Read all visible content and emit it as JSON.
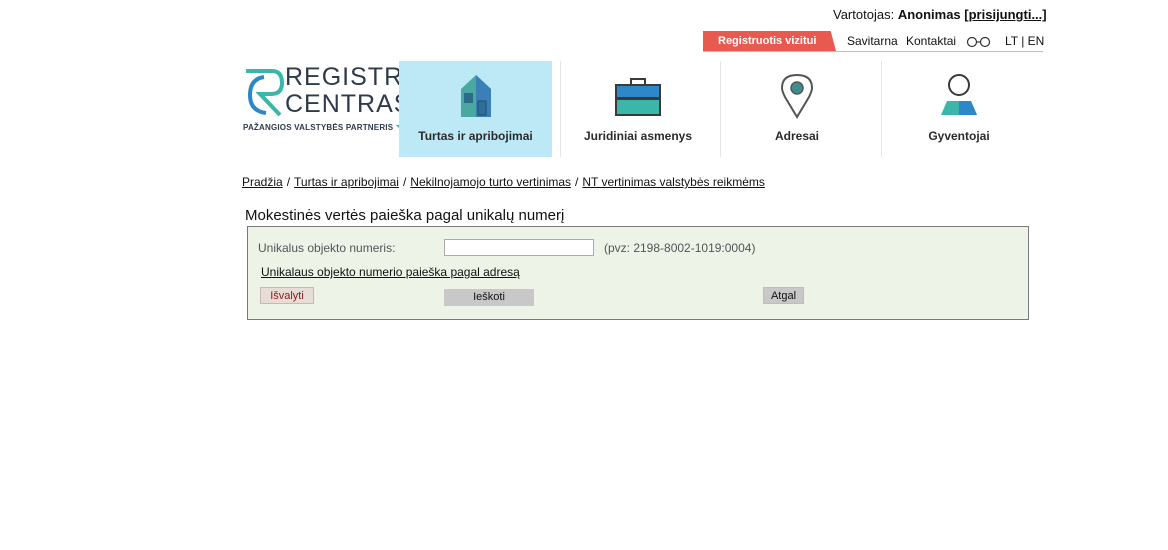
{
  "header": {
    "user_prefix": "Vartotojas:",
    "user_name": "Anonimas",
    "login_link": "[prisijungti...]",
    "register_button": "Registruotis vizitui",
    "links": [
      "Savitarna",
      "Kontaktai"
    ],
    "accessibility_icon": "glasses-icon",
    "language": "LT | EN"
  },
  "logo": {
    "title_line1": "REGISTRŲ",
    "title_line2": "CENTRAS",
    "subtitle": "PAŽANGIOS VALSTYBĖS PARTNERIS",
    "colors": {
      "teal": "#3bb7a9",
      "blue": "#2c88c9",
      "dark": "#2f3b4a"
    }
  },
  "nav": {
    "items": [
      {
        "label": "Turtas ir apribojimai",
        "icon": "house-icon",
        "active": true
      },
      {
        "label": "Juridiniai asmenys",
        "icon": "briefcase-icon",
        "active": false
      },
      {
        "label": "Adresai",
        "icon": "map-pin-icon",
        "active": false
      },
      {
        "label": "Gyventojai",
        "icon": "person-icon",
        "active": false
      }
    ],
    "active_color": "#bde9f7"
  },
  "breadcrumb": [
    "Pradžia",
    "Turtas ir apribojimai",
    "Nekilnojamojo turto vertinimas",
    "NT vertinimas valstybės reikmėms"
  ],
  "page_title": "Mokestinės vertės paieška pagal unikalų numerį",
  "form": {
    "field_label": "Unikalus objekto numeris:",
    "field_value": "",
    "field_hint": "(pvz: 2198-8002-1019:0004)",
    "address_search_link": "Unikalaus objekto numerio paieška pagal adresą",
    "clear_button": "Išvalyti",
    "search_button": "Ieškoti",
    "back_button": "Atgal"
  }
}
